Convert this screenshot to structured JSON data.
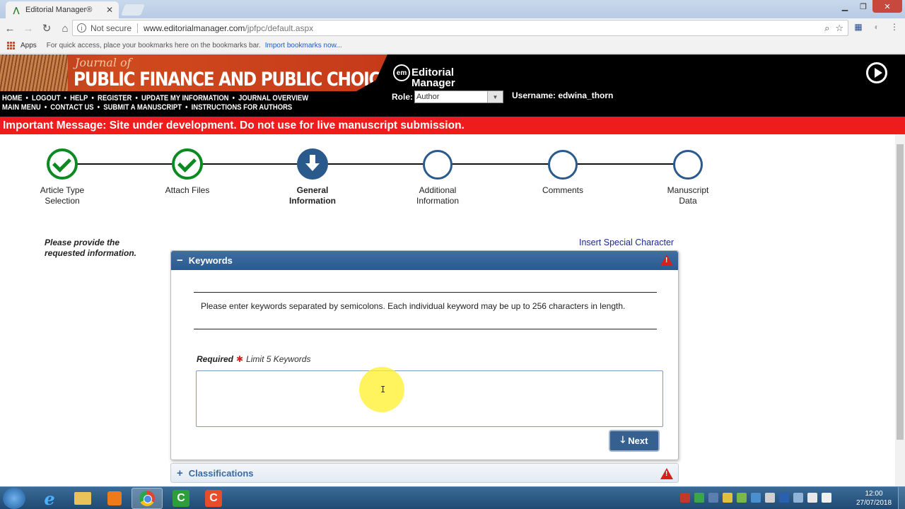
{
  "browser": {
    "tab_title": "Editorial Manager®",
    "tab_close": "✕",
    "address": {
      "security_label": "Not secure",
      "url_host": "www.editorialmanager.com",
      "url_path": "/jpfpc/default.aspx"
    },
    "bookmarks": {
      "apps_label": "Apps",
      "hint": "For quick access, place your bookmarks here on the bookmarks bar.",
      "import_link": "Import bookmarks now..."
    }
  },
  "site": {
    "journal_of": "Journal of",
    "journal_name": "PUBLIC FINANCE AND PUBLIC CHOICE",
    "em_logo": {
      "mark": "em",
      "line1": "Editorial",
      "line2": "Manager"
    },
    "nav_row1": [
      "HOME",
      "LOGOUT",
      "HELP",
      "REGISTER",
      "UPDATE MY INFORMATION",
      "JOURNAL OVERVIEW"
    ],
    "nav_row2": [
      "MAIN MENU",
      "CONTACT US",
      "SUBMIT A MANUSCRIPT",
      "INSTRUCTIONS FOR AUTHORS"
    ],
    "nav_dot": "•",
    "role_label": "Role:",
    "role_value": "Author",
    "username_label": "Username: edwina_thorn",
    "important_message": "Important Message: Site under development. Do not use for live manuscript submission."
  },
  "steps": [
    {
      "line1": "Article Type",
      "line2": "Selection",
      "state": "done"
    },
    {
      "line1": "Attach Files",
      "line2": "",
      "state": "done"
    },
    {
      "line1": "General",
      "line2": "Information",
      "state": "current"
    },
    {
      "line1": "Additional",
      "line2": "Information",
      "state": "todo"
    },
    {
      "line1": "Comments",
      "line2": "",
      "state": "todo"
    },
    {
      "line1": "Manuscript",
      "line2": "Data",
      "state": "todo"
    }
  ],
  "form": {
    "instructions_line1": "Please provide the",
    "instructions_line2": "requested information.",
    "insert_special": "Insert Special Character",
    "keywords_panel": {
      "toggle": "−",
      "title": "Keywords",
      "help_text": "Please enter keywords separated by semicolons. Each individual keyword may be up to 256 characters in length.",
      "required_label": "Required",
      "required_mark": "✱",
      "limit_label": "Limit 5 Keywords",
      "value": "",
      "next_icon": "🡓",
      "next_label": "Next"
    },
    "classifications_panel": {
      "toggle": "+",
      "title": "Classifications"
    }
  },
  "taskbar": {
    "clock_time": "12:00",
    "clock_date": "27/07/2018",
    "ie_glyph": "e",
    "c_glyph": "C"
  },
  "colors": {
    "header_bg": "#000000",
    "important_bg": "#ee1c1c",
    "step_done": "#0b8a22",
    "step_accent": "#2a5a8c",
    "panel_header": "#35608f"
  }
}
